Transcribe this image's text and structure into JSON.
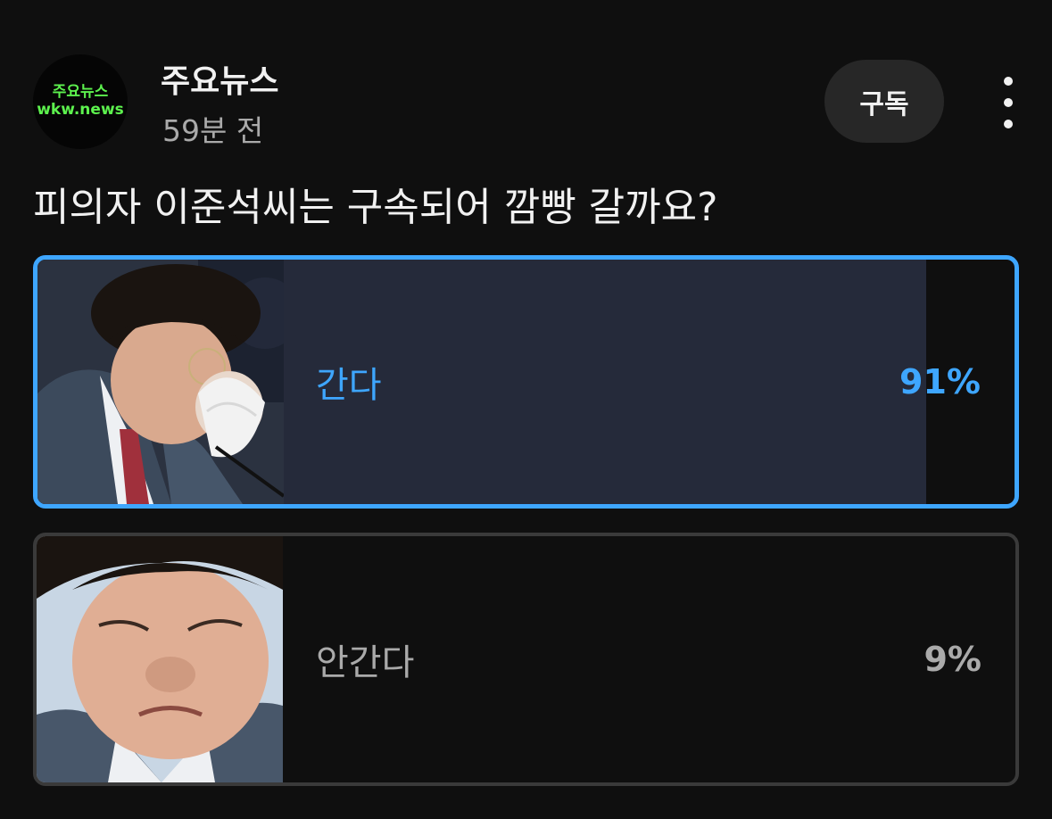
{
  "channel": {
    "name": "주요뉴스",
    "time": "59분 전",
    "avatar_line1": "주요뉴스",
    "avatar_line2": "wkw.news",
    "avatar_text_color": "#5df24e"
  },
  "header": {
    "subscribe_label": "구독",
    "more_icon": "more-vert-icon"
  },
  "poll": {
    "question": "피의자 이준석씨는 구속되어 깜빵 갈까요?",
    "options": [
      {
        "label": "간다",
        "percent": "91%",
        "value": 91,
        "selected": true
      },
      {
        "label": "안간다",
        "percent": "9%",
        "value": 9,
        "selected": false
      }
    ]
  },
  "colors": {
    "background": "#0f0f0f",
    "accent": "#3ea6ff",
    "selected_fill": "#252a3a",
    "unselected_fill": "#3a3a3a"
  }
}
